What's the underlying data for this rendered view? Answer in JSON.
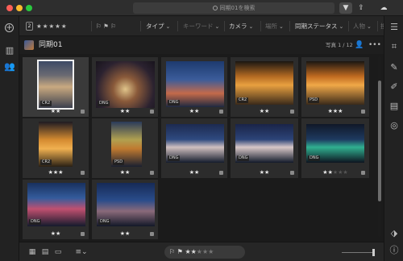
{
  "search": {
    "placeholder": "同期01を検索"
  },
  "filterbar": {
    "rating_count": "2",
    "rating_stars": "★★★★★",
    "flags": "⚐ ⚑ ⚐",
    "type_label": "タイプ",
    "keyword_label": "キーワード",
    "camera_label": "カメラ",
    "location_label": "場所",
    "sync_status_label": "同期ステータス",
    "people_label": "人物",
    "contributor_label": "投稿者"
  },
  "album": {
    "title": "同期01",
    "photo_count": "写真 1 / 12"
  },
  "photos": [
    {
      "format": "CR2",
      "rating": 2
    },
    {
      "format": "DNG",
      "rating": 2
    },
    {
      "format": "DNG",
      "rating": 2
    },
    {
      "format": "CR2",
      "rating": 2
    },
    {
      "format": "PSD",
      "rating": 3
    },
    {
      "format": "CR2",
      "rating": 3
    },
    {
      "format": "PSD",
      "rating": 2
    },
    {
      "format": "DNG",
      "rating": 2
    },
    {
      "format": "DNG",
      "rating": 2
    },
    {
      "format": "DNG",
      "rating": 2
    },
    {
      "format": "DNG",
      "rating": 2
    },
    {
      "format": "DNG",
      "rating": 2
    }
  ],
  "bottombar": {
    "rating_filled": "★★",
    "rating_empty": "★★★"
  },
  "colors": {
    "accent": "#f0f0f0",
    "background": "#1b1b1b"
  }
}
